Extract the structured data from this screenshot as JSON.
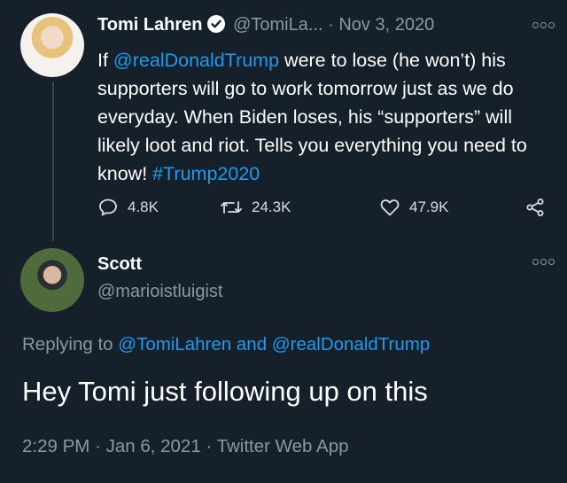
{
  "tweet": {
    "author_name": "Tomi Lahren",
    "handle": "@TomiLa...",
    "separator": "·",
    "date": "Nov 3, 2020",
    "body_parts": [
      {
        "text": "If ",
        "link": false
      },
      {
        "text": "@realDonaldTrump",
        "link": true
      },
      {
        "text": " were to lose (he won’t) his supporters will go to work tomorrow just as we do everyday. When Biden loses, his “supporters” will likely loot and riot. Tells you everything you need to know! ",
        "link": false
      },
      {
        "text": "#Trump2020",
        "link": true
      }
    ],
    "stats": {
      "replies": "4.8K",
      "retweets": "24.3K",
      "likes": "47.9K"
    }
  },
  "reply": {
    "author_name": "Scott",
    "handle": "@marioistluigist",
    "replying_prefix": "Replying to",
    "mention1": "@TomiLahren",
    "and_word": "and",
    "mention2": "@realDonaldTrump",
    "text": "Hey Tomi just following up on this",
    "time": "2:29 PM",
    "sep1": "·",
    "date": "Jan 6, 2021",
    "sep2": "·",
    "source": "Twitter Web App"
  },
  "colors": {
    "background": "#15202b",
    "link": "#1d9bf0",
    "muted": "#8899a6"
  }
}
